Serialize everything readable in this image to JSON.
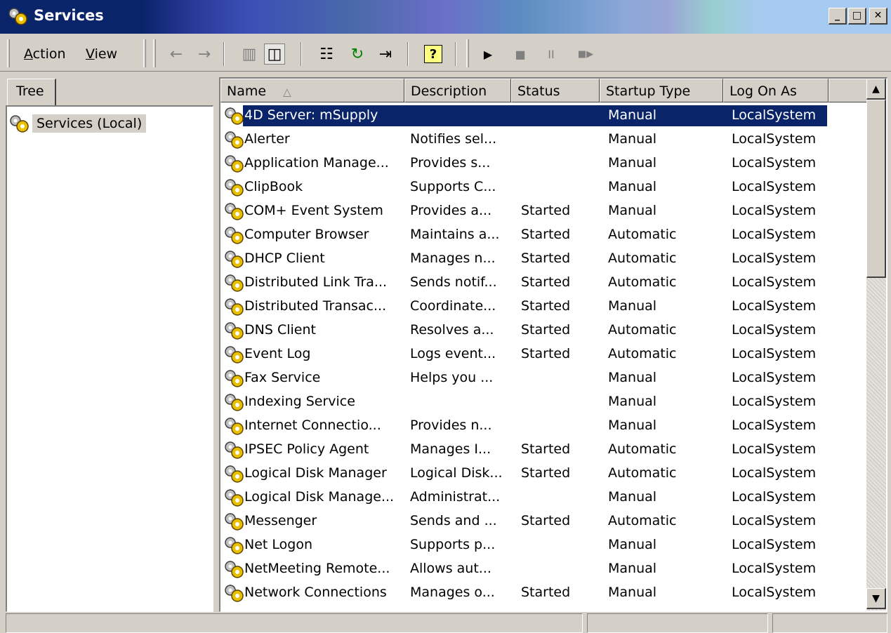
{
  "window": {
    "title": "Services",
    "minimize_label": "_",
    "maximize_label": "□",
    "close_label": "✕"
  },
  "menu": {
    "action": {
      "underline": "A",
      "rest": "ction"
    },
    "view": {
      "underline": "V",
      "rest": "iew"
    }
  },
  "toolbar_icons": {
    "back": "←",
    "forward": "→",
    "up_folder": "▥",
    "show_tree": "◫",
    "properties": "☷",
    "refresh": "↻",
    "export": "⇥",
    "help": "?",
    "start": "▶",
    "stop": "■",
    "pause": "II",
    "restart": "■▶"
  },
  "tree": {
    "tab_label": "Tree",
    "root_label": "Services (Local)"
  },
  "list": {
    "columns": {
      "name": "Name",
      "name_sort_indicator": "△",
      "description": "Description",
      "status": "Status",
      "startup_type": "Startup Type",
      "log_on_as": "Log On As"
    },
    "rows": [
      {
        "name": "4D Server: mSupply",
        "description": "",
        "status": "",
        "startup": "Manual",
        "logon": "LocalSystem"
      },
      {
        "name": "Alerter",
        "description": "Notifies sel...",
        "status": "",
        "startup": "Manual",
        "logon": "LocalSystem"
      },
      {
        "name": "Application Manage...",
        "description": "Provides s...",
        "status": "",
        "startup": "Manual",
        "logon": "LocalSystem"
      },
      {
        "name": "ClipBook",
        "description": "Supports C...",
        "status": "",
        "startup": "Manual",
        "logon": "LocalSystem"
      },
      {
        "name": "COM+ Event System",
        "description": "Provides a...",
        "status": "Started",
        "startup": "Manual",
        "logon": "LocalSystem"
      },
      {
        "name": "Computer Browser",
        "description": "Maintains a...",
        "status": "Started",
        "startup": "Automatic",
        "logon": "LocalSystem"
      },
      {
        "name": "DHCP Client",
        "description": "Manages n...",
        "status": "Started",
        "startup": "Automatic",
        "logon": "LocalSystem"
      },
      {
        "name": "Distributed Link Tra...",
        "description": "Sends notif...",
        "status": "Started",
        "startup": "Automatic",
        "logon": "LocalSystem"
      },
      {
        "name": "Distributed Transac...",
        "description": "Coordinate...",
        "status": "Started",
        "startup": "Manual",
        "logon": "LocalSystem"
      },
      {
        "name": "DNS Client",
        "description": "Resolves a...",
        "status": "Started",
        "startup": "Automatic",
        "logon": "LocalSystem"
      },
      {
        "name": "Event Log",
        "description": "Logs event...",
        "status": "Started",
        "startup": "Automatic",
        "logon": "LocalSystem"
      },
      {
        "name": "Fax Service",
        "description": "Helps you ...",
        "status": "",
        "startup": "Manual",
        "logon": "LocalSystem"
      },
      {
        "name": "Indexing Service",
        "description": "",
        "status": "",
        "startup": "Manual",
        "logon": "LocalSystem"
      },
      {
        "name": "Internet Connectio...",
        "description": "Provides n...",
        "status": "",
        "startup": "Manual",
        "logon": "LocalSystem"
      },
      {
        "name": "IPSEC Policy Agent",
        "description": "Manages I...",
        "status": "Started",
        "startup": "Automatic",
        "logon": "LocalSystem"
      },
      {
        "name": "Logical Disk Manager",
        "description": "Logical Disk...",
        "status": "Started",
        "startup": "Automatic",
        "logon": "LocalSystem"
      },
      {
        "name": "Logical Disk Manage...",
        "description": "Administrat...",
        "status": "",
        "startup": "Manual",
        "logon": "LocalSystem"
      },
      {
        "name": "Messenger",
        "description": "Sends and ...",
        "status": "Started",
        "startup": "Automatic",
        "logon": "LocalSystem"
      },
      {
        "name": "Net Logon",
        "description": "Supports p...",
        "status": "",
        "startup": "Manual",
        "logon": "LocalSystem"
      },
      {
        "name": "NetMeeting Remote...",
        "description": "Allows aut...",
        "status": "",
        "startup": "Manual",
        "logon": "LocalSystem"
      },
      {
        "name": "Network Connections",
        "description": "Manages o...",
        "status": "Started",
        "startup": "Manual",
        "logon": "LocalSystem"
      }
    ],
    "selected_index": 0
  },
  "scrollbar": {
    "up_arrow": "▲",
    "down_arrow": "▼"
  },
  "colors": {
    "title_bar_start": "#0a246a",
    "selection": "#0a246a",
    "face": "#d4d0c8"
  }
}
